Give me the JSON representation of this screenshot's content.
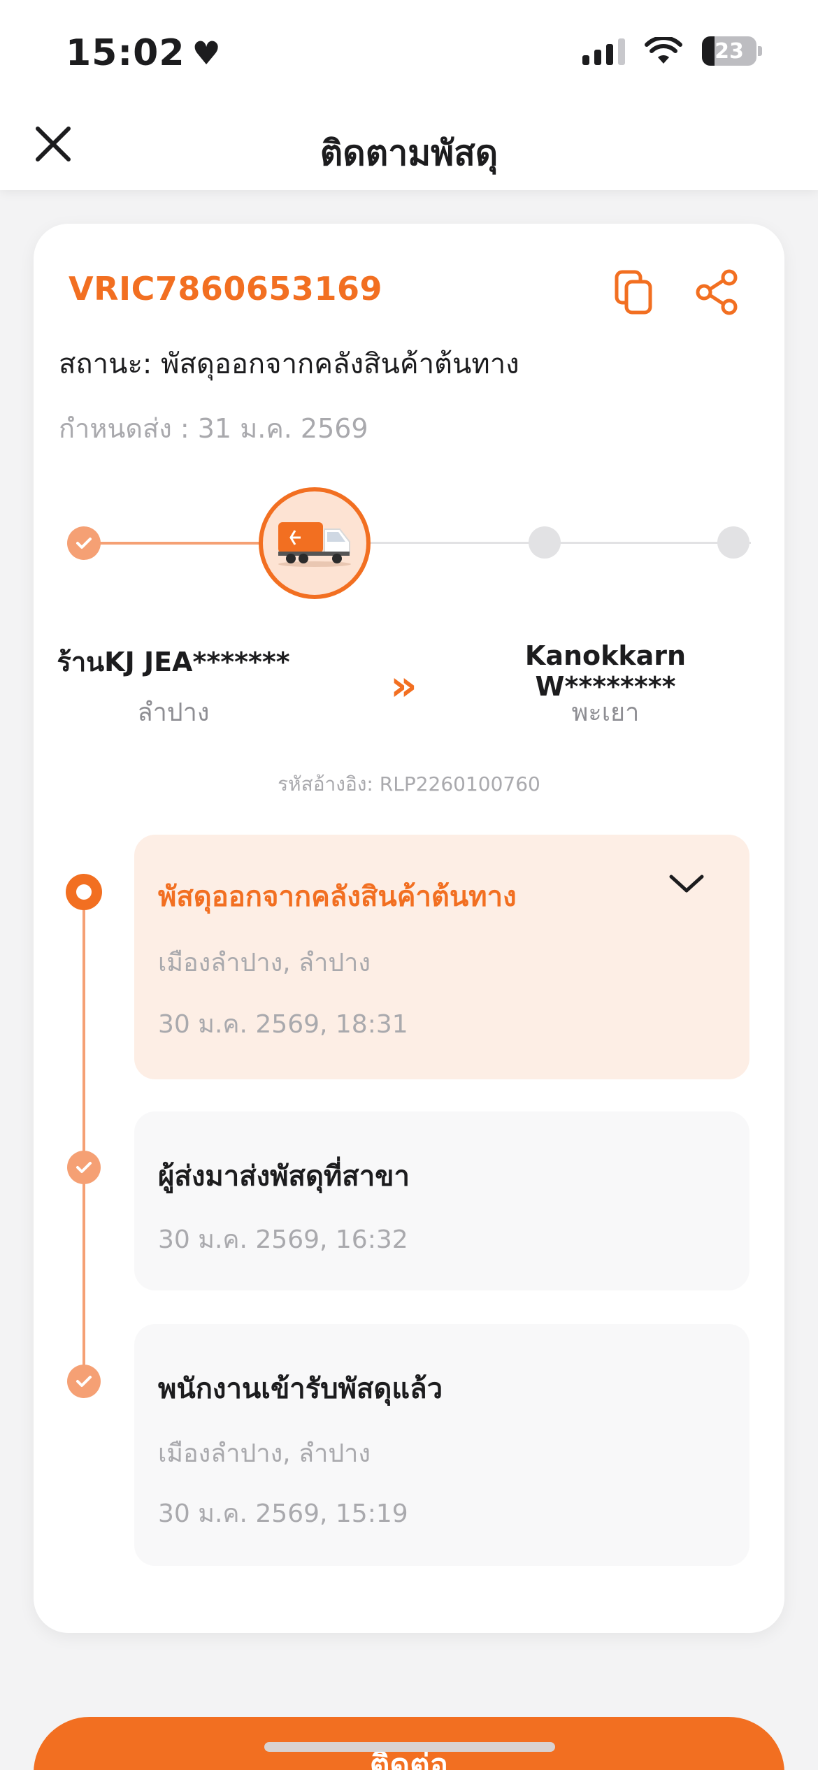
{
  "status_bar": {
    "time": "15:02",
    "battery": "23"
  },
  "header": {
    "title": "ติดตามพัสดุ"
  },
  "parcel": {
    "tracking_number": "VRIC7860653169",
    "status_text": "สถานะ: พัสดุออกจากคลังสินค้าต้นทาง",
    "due_text": "กำหนดส่ง : 31 ม.ค. 2569",
    "reference": "รหัสอ้างอิง: RLP2260100760"
  },
  "sender": {
    "name": "ร้านKJ JEA*******",
    "city": "ลำปาง"
  },
  "receiver": {
    "name": "Kanokkarn W********",
    "city": "พะเยา"
  },
  "route_arrows": "»",
  "events": [
    {
      "title": "พัสดุออกจากคลังสินค้าต้นทาง",
      "location": "เมืองลำปาง, ลำปาง",
      "datetime": "30 ม.ค. 2569, 18:31"
    },
    {
      "title": "ผู้ส่งมาส่งพัสดุที่สาขา",
      "datetime": "30 ม.ค. 2569, 16:32"
    },
    {
      "title": "พนักงานเข้ารับพัสดุแล้ว",
      "location": "เมืองลำปาง, ลำปาง",
      "datetime": "30 ม.ค. 2569, 15:19"
    }
  ],
  "bottom_button": {
    "label": "ติดต่อ"
  },
  "colors": {
    "accent": "#f26f21",
    "accent_light": "#f5a074",
    "active_bg": "#fdeee5"
  },
  "icons": {
    "close": "close-icon",
    "copy": "copy-icon",
    "share": "share-icon",
    "truck": "truck-icon",
    "check": "check-icon",
    "chevron": "chevron-down-icon",
    "heart": "heart-icon"
  }
}
